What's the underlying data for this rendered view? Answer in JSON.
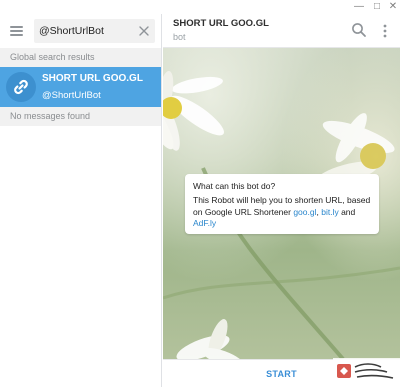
{
  "window": {
    "controls": {
      "minimize": "—",
      "maximize": "□",
      "close": "✕"
    }
  },
  "sidebar": {
    "search": {
      "value": "@ShortUrlBot",
      "placeholder": "Search"
    },
    "global_header": "Global search results",
    "results": [
      {
        "name": "SHORT URL GOO.GL",
        "username": "@ShortUrlBot",
        "avatar_icon": "link-icon",
        "selected": true
      }
    ],
    "messages_header": "No messages found"
  },
  "chat": {
    "title": "SHORT URL GOO.GL",
    "status": "bot",
    "bubble": {
      "title": "What can this bot do?",
      "text_start": "This Robot will help you to shorten URL, based on Google URL Shortener ",
      "link1": "goo.gl",
      "sep1": ", ",
      "link2": "bit.ly",
      "and": " and ",
      "link3": "AdF.ly"
    },
    "start_label": "START"
  },
  "colors": {
    "accent": "#4ea4e2",
    "link": "#2a86cc",
    "start": "#3a8ed6"
  }
}
